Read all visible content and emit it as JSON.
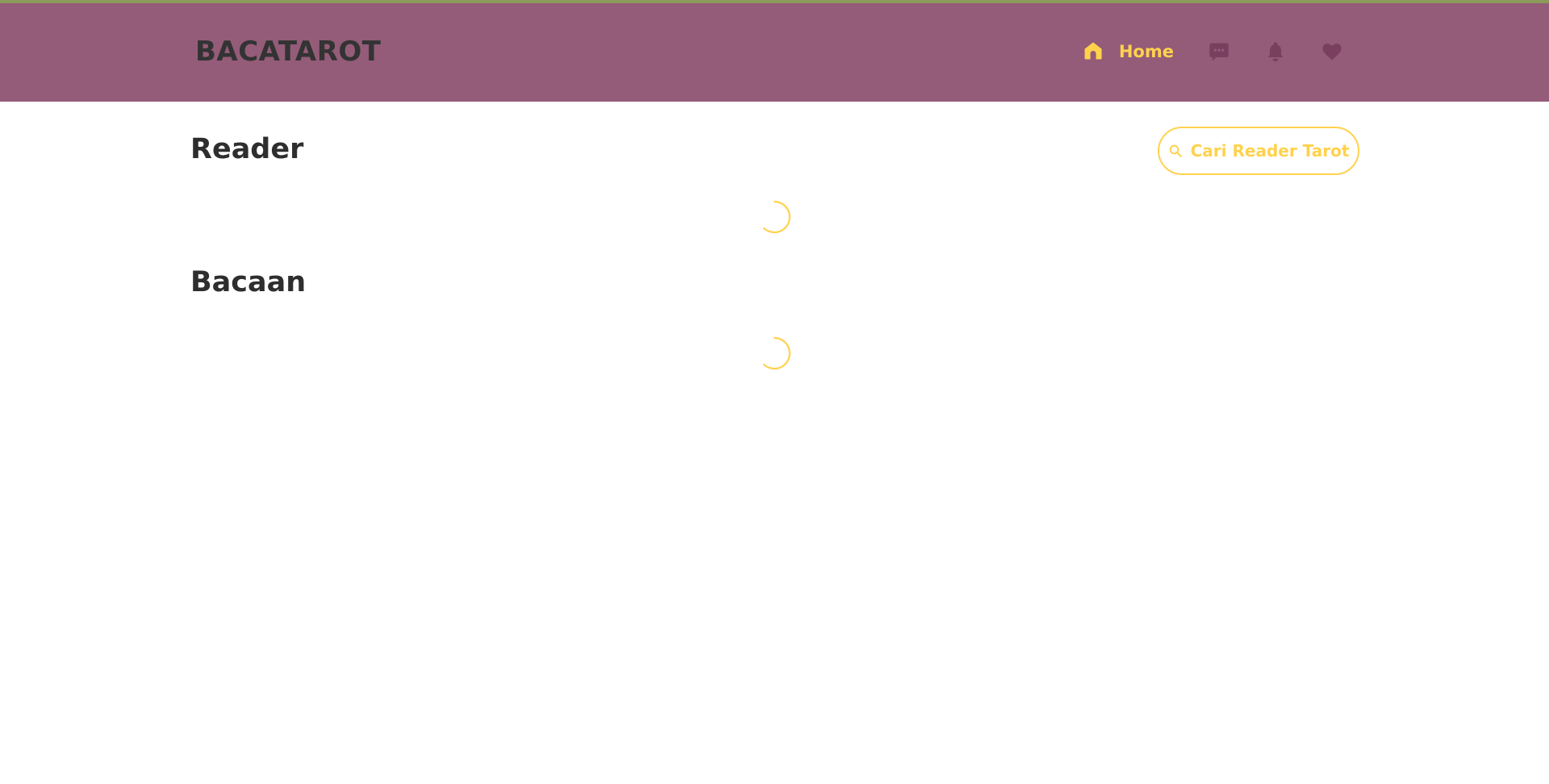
{
  "header": {
    "brand": "BACATAROT",
    "nav": {
      "home_label": "Home",
      "icons": [
        "home-icon",
        "chat-icon",
        "bell-icon",
        "heart-icon"
      ]
    }
  },
  "reader_section": {
    "title": "Reader",
    "search_button_label": "Cari Reader Tarot"
  },
  "reading_section": {
    "title": "Bacaan"
  },
  "colors": {
    "navbar": "#945c78",
    "accent": "#ffd24d",
    "topline": "#8c9a5a",
    "nav_icon_inactive": "#7a3f5f",
    "heading": "#2e2e2e"
  }
}
